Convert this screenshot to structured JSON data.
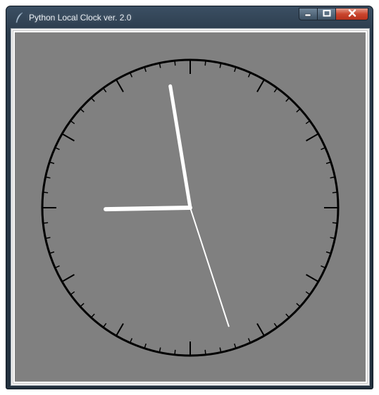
{
  "window": {
    "title": "Python Local Clock ver. 2.0",
    "app_icon": "feather-icon",
    "buttons": {
      "minimize_icon": "minimize-icon",
      "maximize_icon": "maximize-icon",
      "close_icon": "close-icon"
    }
  },
  "clock": {
    "face_color": "#808080",
    "dial_color": "#000000",
    "hand_color": "#ffffff",
    "tick_count": 60,
    "time": {
      "hours": 8,
      "minutes": 58,
      "seconds": 27
    }
  }
}
